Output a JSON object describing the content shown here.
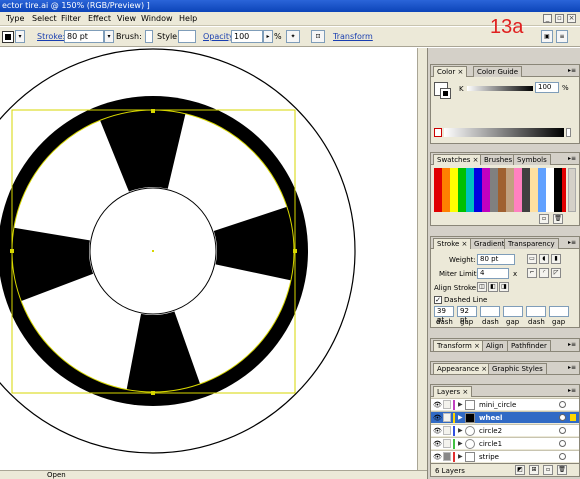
{
  "window": {
    "title": "ector tire.ai @ 150% (RGB/Preview) ]"
  },
  "menu": {
    "items": [
      "Type",
      "Select",
      "Filter",
      "Effect",
      "View",
      "Window",
      "Help"
    ]
  },
  "options": {
    "stroke_label": "Stroke:",
    "stroke_value": "80 pt",
    "brush_label": "Brush:",
    "style_label": "Style:",
    "opacity_label": "Opacity:",
    "opacity_value": "100",
    "opacity_unit": "%",
    "transform_label": "Transform"
  },
  "annotation": "13a",
  "status": {
    "open_label": "Open"
  },
  "color_panel": {
    "tabs": [
      "Color",
      "Color Guide"
    ],
    "channel": "K",
    "value": "100",
    "unit": "%"
  },
  "swatches_panel": {
    "tabs": [
      "Swatches",
      "Brushes",
      "Symbols"
    ]
  },
  "stroke_panel": {
    "tabs": [
      "Stroke",
      "Gradient",
      "Transparency"
    ],
    "weight_label": "Weight:",
    "weight_value": "80 pt",
    "miter_label": "Miter Limit:",
    "miter_value": "4",
    "miter_unit": "x",
    "align_label": "Align Stroke:",
    "dashed_label": "Dashed Line",
    "dashed_checked": true,
    "dash_values": [
      "39 pt",
      "92 pt",
      "",
      "",
      "",
      ""
    ],
    "dash_labels": [
      "dash",
      "gap",
      "dash",
      "gap",
      "dash",
      "gap"
    ]
  },
  "transform_panel": {
    "tabs": [
      "Transform",
      "Align",
      "Pathfinder"
    ]
  },
  "appearance_panel": {
    "tabs": [
      "Appearance",
      "Graphic Styles"
    ]
  },
  "layers_panel": {
    "tabs": [
      "Layers"
    ],
    "layers": [
      {
        "name": "mini_circle",
        "color": "#c040c0"
      },
      {
        "name": "wheel",
        "color": "#ffd700"
      },
      {
        "name": "circle2",
        "color": "#3050e0"
      },
      {
        "name": "circle1",
        "color": "#40c040"
      },
      {
        "name": "stripe",
        "color": "#e03030"
      }
    ],
    "selected_index": 1,
    "count_label": "6 Layers"
  },
  "colors": {
    "selection": "#d7d700",
    "accent": "#316ac5",
    "annotation": "#e02020"
  }
}
